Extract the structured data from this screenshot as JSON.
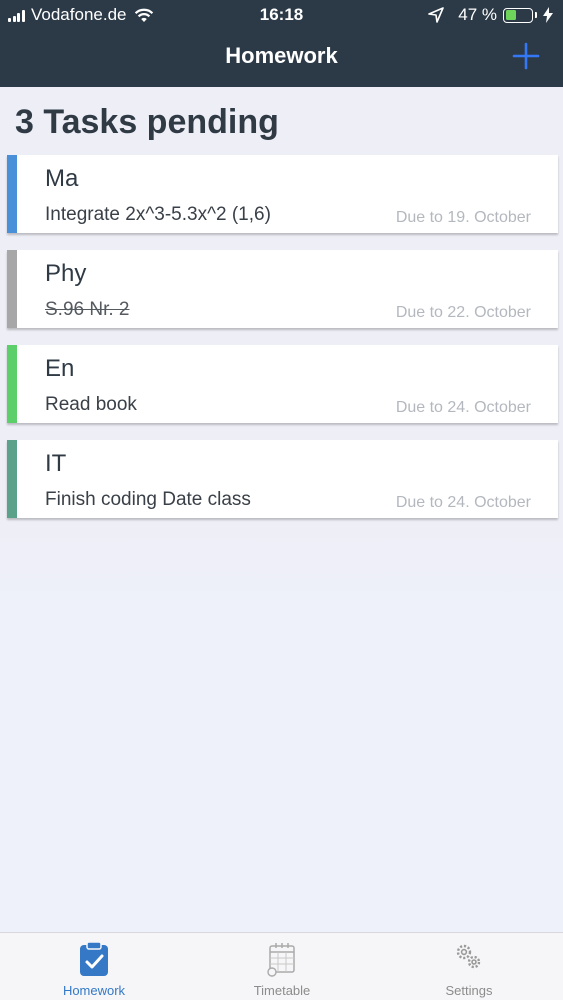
{
  "status_bar": {
    "carrier": "Vodafone.de",
    "time": "16:18",
    "battery_percent": "47 %",
    "battery_level": 0.47,
    "battery_color": "#6ed35a"
  },
  "nav": {
    "title": "Homework",
    "add_icon": "plus-icon",
    "accent_color": "#3478f6"
  },
  "header_text": "3 Tasks pending",
  "tasks": [
    {
      "subject": "Ma",
      "description": "Integrate 2x^3-5.3x^2 (1,6)",
      "due": "Due to 19. October",
      "color": "#4a90d9",
      "done": false
    },
    {
      "subject": "Phy",
      "description": "S.96 Nr. 2",
      "due": "Due to 22. October",
      "color": "#a7a7a7",
      "done": true
    },
    {
      "subject": "En",
      "description": "Read book",
      "due": "Due to 24. October",
      "color": "#5ccf6a",
      "done": false
    },
    {
      "subject": "IT",
      "description": "Finish coding Date class",
      "due": "Due to 24. October",
      "color": "#5aa38a",
      "done": false
    }
  ],
  "tabs": [
    {
      "label": "Homework",
      "icon": "clipboard-check-icon",
      "active": true
    },
    {
      "label": "Timetable",
      "icon": "calendar-icon",
      "active": false
    },
    {
      "label": "Settings",
      "icon": "gears-icon",
      "active": false
    }
  ]
}
